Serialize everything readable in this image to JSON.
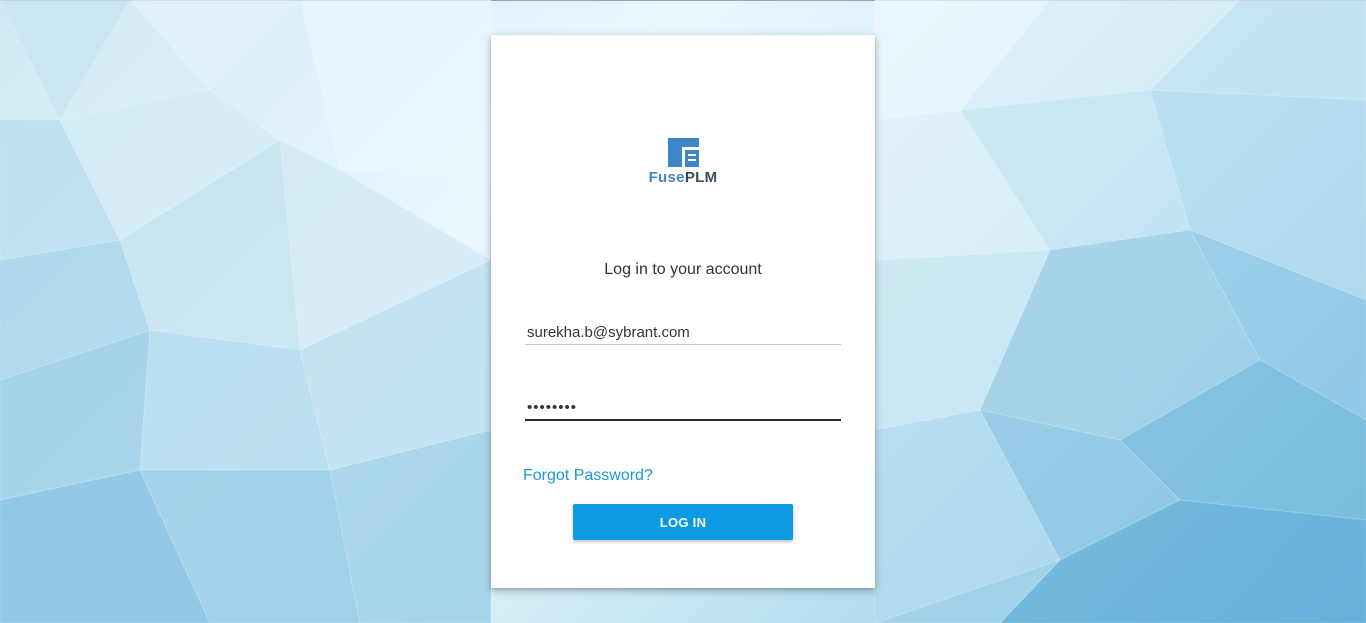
{
  "brand": {
    "name_part1": "Fuse",
    "name_part2": "PLM",
    "logo_icon": "fuseplm-logo-icon",
    "primary_color": "#3d87c9",
    "secondary_color": "#3c4a5c"
  },
  "login": {
    "title": "Log in to your account",
    "email_value": "surekha.b@sybrant.com",
    "password_value": "ssssssss",
    "forgot_password_label": "Forgot Password?",
    "login_button_label": "LOG IN",
    "accent_color": "#0c9be3"
  }
}
